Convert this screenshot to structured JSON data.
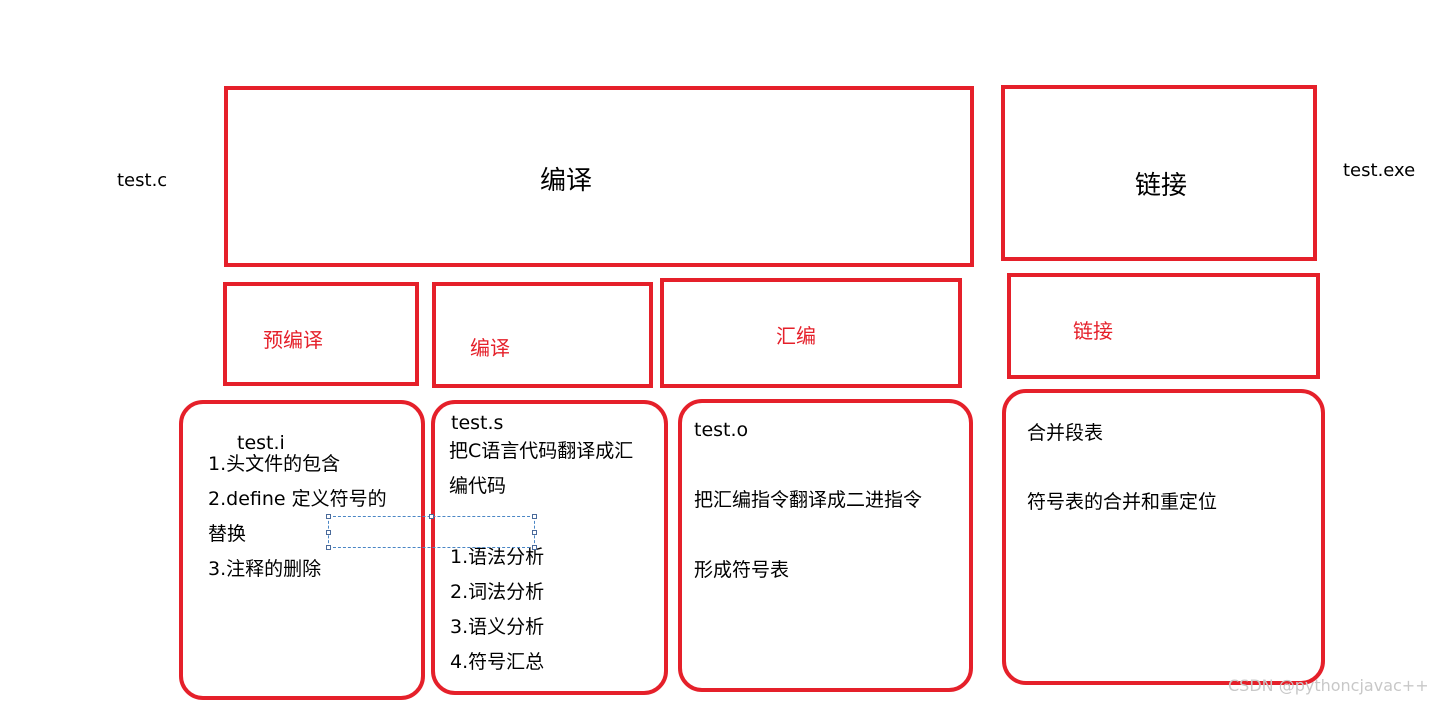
{
  "inputs": {
    "source": "test.c",
    "output": "test.exe"
  },
  "stages": {
    "compile": "编译",
    "link": "链接"
  },
  "substages": {
    "precompile": "预编译",
    "compile": "编译",
    "assemble": "汇编",
    "link": "链接"
  },
  "details": {
    "precompile": {
      "file": "test.i",
      "lines": [
        "1.头文件的包含",
        "2.define 定义符号的",
        "替换",
        "3.注释的删除"
      ]
    },
    "compile": {
      "file": "test.s",
      "desc": [
        "把C语言代码翻译成汇",
        "编代码"
      ],
      "lines": [
        "1.语法分析",
        "2.词法分析",
        "3.语义分析",
        "4.符号汇总"
      ]
    },
    "assemble": {
      "file": "test.o",
      "lines": [
        "把汇编指令翻译成二进指令",
        "形成符号表"
      ]
    },
    "link": {
      "lines": [
        "合并段表",
        "符号表的合并和重定位"
      ]
    }
  },
  "watermark": "CSDN @pythoncjavac++",
  "colors": {
    "border": "#e5202a",
    "subtitle_text": "#e5202a",
    "selection": "#4a86c5",
    "watermark": "#c8c8c8"
  }
}
